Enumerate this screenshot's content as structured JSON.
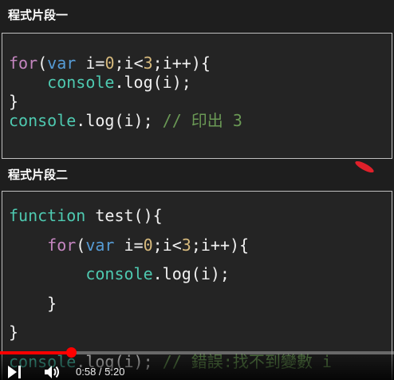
{
  "section1": {
    "heading": "程式片段一",
    "lines": [
      [
        [
          "kw",
          "for"
        ],
        [
          "id",
          "("
        ],
        [
          "blue",
          "var"
        ],
        [
          "id",
          " i"
        ],
        [
          "id",
          "="
        ],
        [
          "num",
          "0"
        ],
        [
          "id",
          ";i<"
        ],
        [
          "num",
          "3"
        ],
        [
          "id",
          ";i++){"
        ]
      ],
      [
        [
          "id",
          "    "
        ],
        [
          "fn",
          "console"
        ],
        [
          "id",
          ".log(i);"
        ]
      ],
      [
        [
          "id",
          "}"
        ]
      ],
      [
        [
          "fn",
          "console"
        ],
        [
          "id",
          ".log(i); "
        ],
        [
          "cm",
          "// 印出 3"
        ]
      ]
    ]
  },
  "section2": {
    "heading": "程式片段二",
    "lines": [
      [
        [
          "fn",
          "function"
        ],
        [
          "id",
          " test(){"
        ]
      ],
      [
        [
          "id",
          "    "
        ],
        [
          "kw",
          "for"
        ],
        [
          "id",
          "("
        ],
        [
          "blue",
          "var"
        ],
        [
          "id",
          " i"
        ],
        [
          "id",
          "="
        ],
        [
          "num",
          "0"
        ],
        [
          "id",
          ";i<"
        ],
        [
          "num",
          "3"
        ],
        [
          "id",
          ";i++){"
        ]
      ],
      [
        [
          "id",
          "        "
        ],
        [
          "fn",
          "console"
        ],
        [
          "id",
          ".log(i);"
        ]
      ],
      [
        [
          "id",
          "    }"
        ]
      ],
      [
        [
          "id",
          "}"
        ]
      ],
      [
        [
          "fn",
          "console"
        ],
        [
          "id",
          ".log(i); "
        ],
        [
          "cm",
          "// 錯誤:找不到變數 i"
        ]
      ]
    ]
  },
  "player": {
    "time_display": "0:58 / 5:20",
    "progress_fraction": 0.181,
    "icons": {
      "play": "play-next-icon",
      "volume": "volume-icon"
    },
    "accent": "#ff0000"
  }
}
